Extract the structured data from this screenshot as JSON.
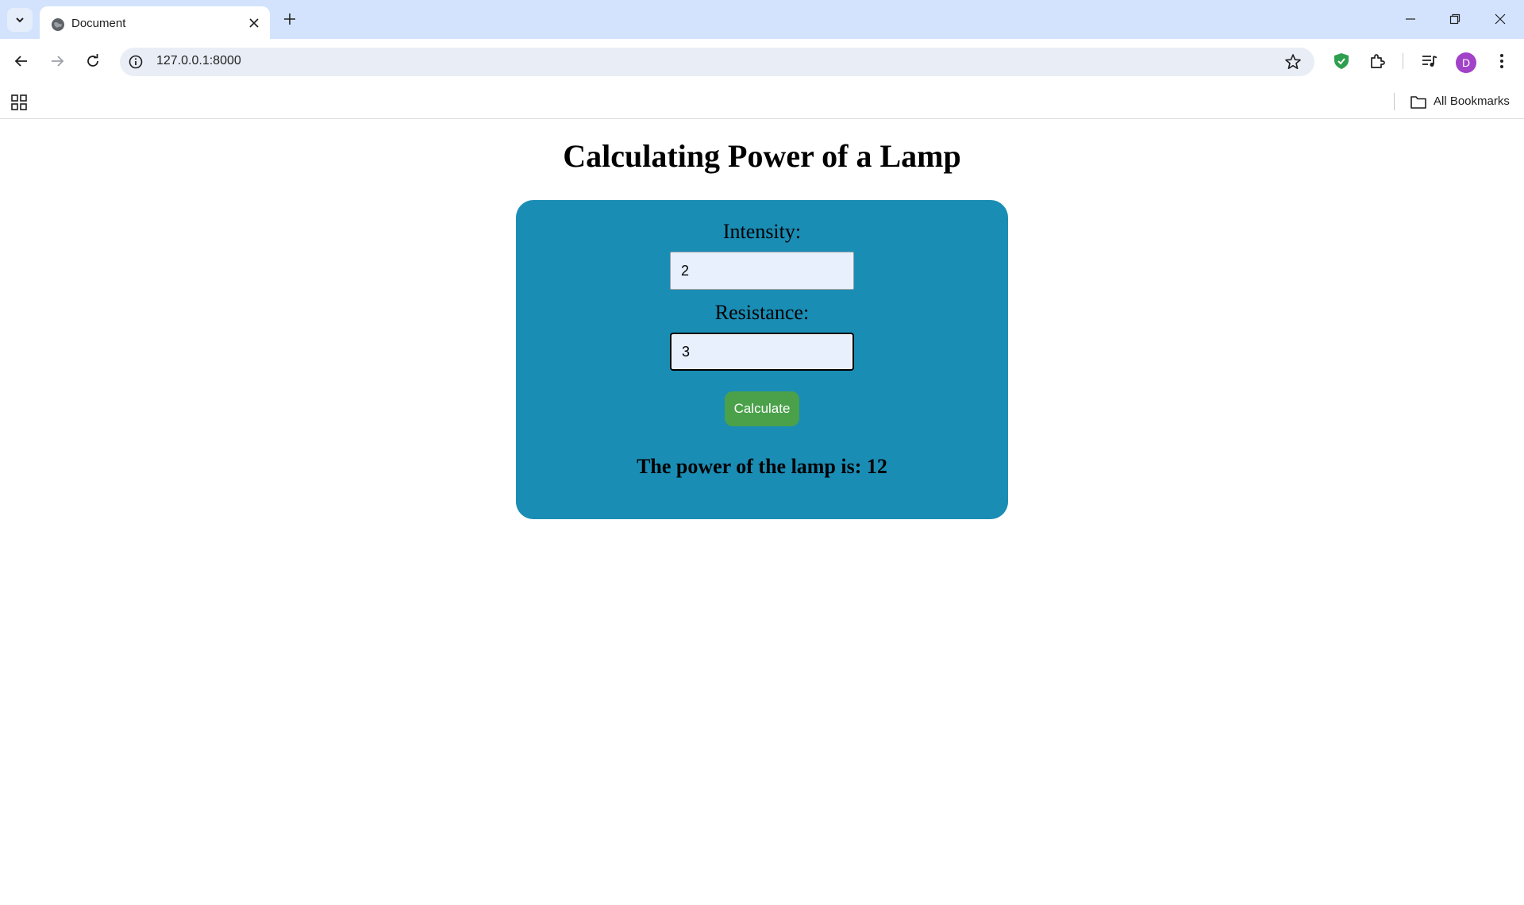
{
  "browser": {
    "tab_title": "Document",
    "url": "127.0.0.1:8000",
    "profile_initial": "D",
    "bookmarks_label": "All Bookmarks",
    "icons": [
      "tab-search-icon",
      "globe-icon",
      "close-icon",
      "plus-icon",
      "minimize-icon",
      "restore-icon",
      "window-close-icon",
      "back-icon",
      "forward-icon",
      "reload-icon",
      "info-icon",
      "star-icon",
      "shield-icon",
      "extensions-icon",
      "media-icon",
      "menu-icon",
      "apps-icon",
      "folder-icon"
    ],
    "colors": {
      "tabstrip": "#d3e3fd",
      "omnibox": "#e9eef6",
      "avatar": "#a142c8",
      "shield": "#2e9e4f"
    }
  },
  "page": {
    "title": "Calculating Power of a Lamp",
    "intensity_label": "Intensity:",
    "intensity_value": "2",
    "resistance_label": "Resistance:",
    "resistance_value": "3",
    "calculate_label": "Calculate",
    "result_text": "The power of the lamp is: 12",
    "colors": {
      "card": "#1a8db5",
      "button": "#4aa14a",
      "input_bg": "#e8f0fe"
    }
  }
}
